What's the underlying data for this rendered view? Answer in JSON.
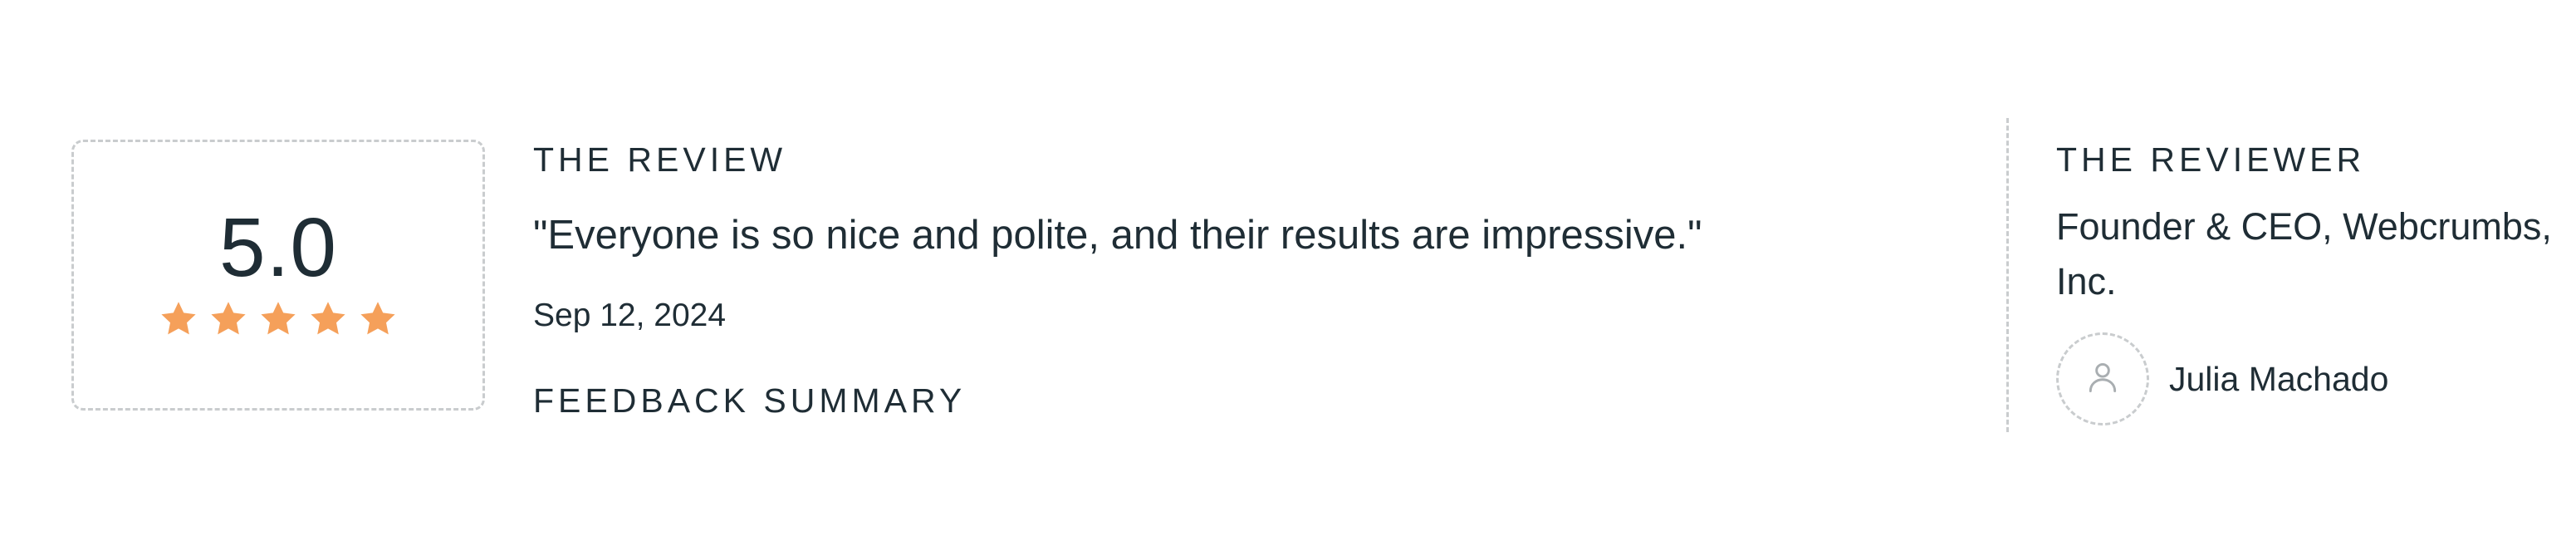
{
  "rating": {
    "score": "5.0",
    "stars": 5,
    "star_color": "#f5a05a",
    "star_icon": "star-icon"
  },
  "review": {
    "heading": "THE REVIEW",
    "quote": "\"Everyone is so nice and polite, and their results are impressive.\"",
    "date": "Sep 12, 2024",
    "feedback_heading": "FEEDBACK SUMMARY"
  },
  "reviewer": {
    "heading": "THE REVIEWER",
    "title": "Founder & CEO, Webcrumbs, Inc.",
    "name": "Julia Machado",
    "avatar_icon": "user-icon"
  },
  "colors": {
    "text": "#1f2d35",
    "border": "#c9ccce",
    "accent": "#f5a05a"
  }
}
